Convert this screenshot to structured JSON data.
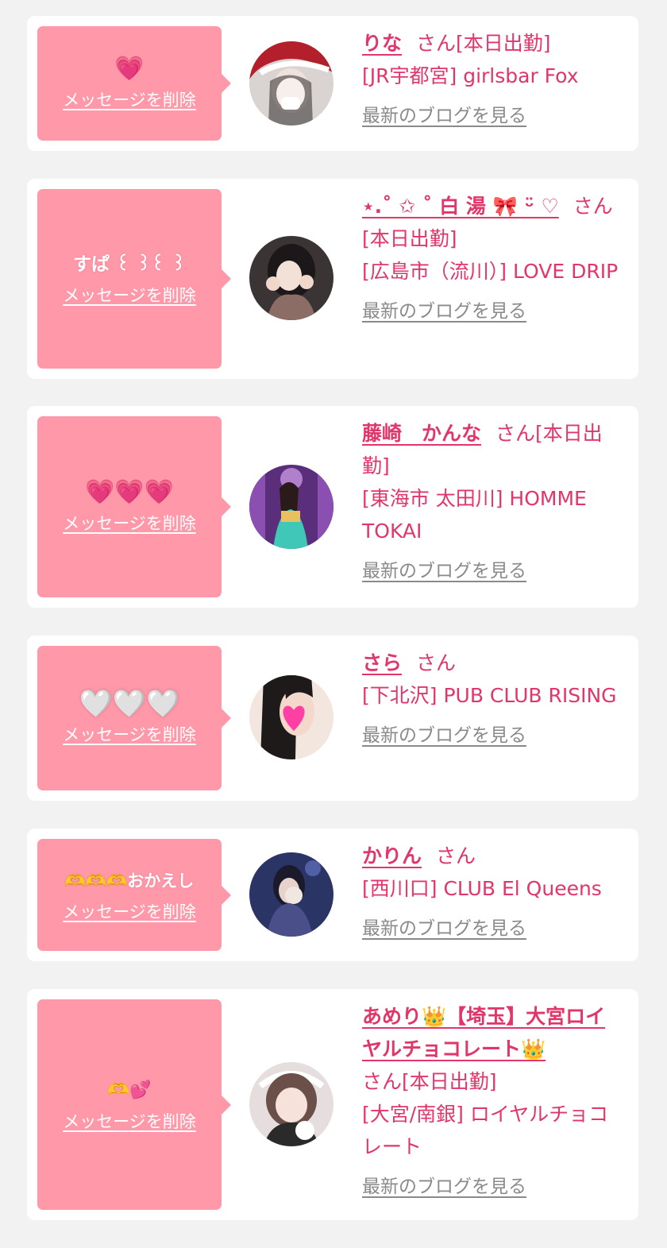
{
  "entries": [
    {
      "message": "💗",
      "delete_label": "メッセージを削除",
      "name": "りな",
      "suffix": "さん[本日出勤]",
      "shop": "[JR宇都宮] girlsbar Fox",
      "blog_label": "最新のブログを見る"
    },
    {
      "message": "すぱ ꒰ ꒱꒰ ꒱",
      "delete_label": "メッセージを削除",
      "name": "⋆.˚ ✩ ˚ 白 湯 🎀 ᵕ̈ ♡",
      "suffix": "さん[本日出勤]",
      "shop": "[広島市（流川）] LOVE DRIP",
      "blog_label": "最新のブログを見る"
    },
    {
      "message": "💗💗💗",
      "delete_label": "メッセージを削除",
      "name": "藤崎　かんな",
      "suffix": "さん[本日出勤]",
      "shop": "[東海市 太田川] HOMME TOKAI",
      "blog_label": "最新のブログを見る"
    },
    {
      "message": "🤍🤍🤍",
      "delete_label": "メッセージを削除",
      "name": "さら",
      "suffix": "さん",
      "shop": "[下北沢] PUB CLUB RISING",
      "blog_label": "最新のブログを見る"
    },
    {
      "message": "🫶🫶🫶おかえし",
      "delete_label": "メッセージを削除",
      "name": "かりん",
      "suffix": "さん",
      "shop": "[西川口] CLUB El Queens",
      "blog_label": "最新のブログを見る"
    },
    {
      "message": "🫶💕",
      "delete_label": "メッセージを削除",
      "name": "あめり👑【埼玉】大宮ロイヤルチョコレート👑",
      "suffix": "さん[本日出勤]",
      "shop": "[大宮/南銀] ロイヤルチョコレート",
      "blog_label": "最新のブログを見る"
    }
  ]
}
